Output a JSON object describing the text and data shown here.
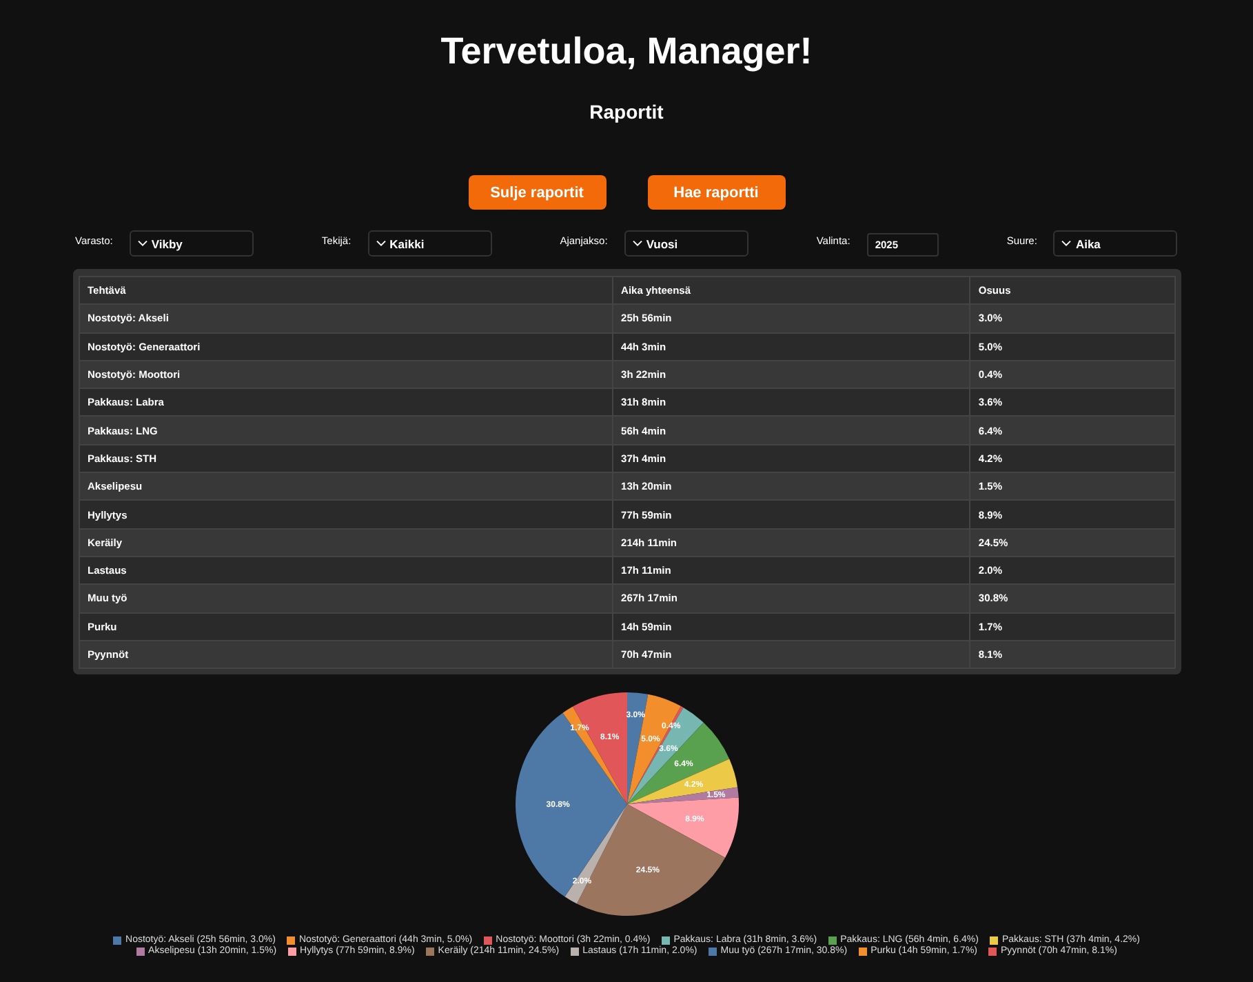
{
  "title": "Tervetuloa, Manager!",
  "subtitle": "Raportit",
  "buttons": [
    "Sulje raportit",
    "Hae raportti"
  ],
  "filters": [
    {
      "kind": "select",
      "label": "Varasto:",
      "value": "Vikby"
    },
    {
      "kind": "select",
      "label": "Tekijä:",
      "value": "Kaikki"
    },
    {
      "kind": "select",
      "label": "Ajanjakso:",
      "value": "Vuosi"
    },
    {
      "kind": "input",
      "label": "Valinta:",
      "value": "2025"
    },
    {
      "kind": "select",
      "label": "Suure:",
      "value": "Aika"
    }
  ],
  "table": {
    "columns": [
      "Tehtävä",
      "Aika yhteensä",
      "Osuus"
    ],
    "rows": [
      [
        "Nostotyö: Akseli",
        "25h 56min",
        "3.0%"
      ],
      [
        "Nostotyö: Generaattori",
        "44h 3min",
        "5.0%"
      ],
      [
        "Nostotyö: Moottori",
        "3h 22min",
        "0.4%"
      ],
      [
        "Pakkaus: Labra",
        "31h 8min",
        "3.6%"
      ],
      [
        "Pakkaus: LNG",
        "56h 4min",
        "6.4%"
      ],
      [
        "Pakkaus: STH",
        "37h 4min",
        "4.2%"
      ],
      [
        "Akselipesu",
        "13h 20min",
        "1.5%"
      ],
      [
        "Hyllytys",
        "77h 59min",
        "8.9%"
      ],
      [
        "Keräily",
        "214h 11min",
        "24.5%"
      ],
      [
        "Lastaus",
        "17h 11min",
        "2.0%"
      ],
      [
        "Muu työ",
        "267h 17min",
        "30.8%"
      ],
      [
        "Purku",
        "14h 59min",
        "1.7%"
      ],
      [
        "Pyynnöt",
        "70h 47min",
        "8.1%"
      ]
    ]
  },
  "chart": {
    "legend": [
      "Nostotyö: Akseli (25h 56min, 3.0%)",
      "Nostotyö: Generaattori (44h 3min, 5.0%)",
      "Nostotyö: Moottori (3h 22min, 0.4%)",
      "Pakkaus: Labra (31h 8min, 3.6%)",
      "Pakkaus: LNG (56h 4min, 6.4%)",
      "Pakkaus: STH (37h 4min, 4.2%)",
      "Akselipesu (13h 20min, 1.5%)",
      "Hyllytys (77h 59min, 8.9%)",
      "Keräily (214h 11min, 24.5%)",
      "Lastaus (17h 11min, 2.0%)",
      "Muu työ (267h 17min, 30.8%)",
      "Purku (14h 59min, 1.7%)",
      "Pyynnöt (70h 47min, 8.1%)"
    ],
    "chart_data": {
      "type": "pie",
      "series": [
        {
          "values": [
            3.0,
            5.0,
            0.4,
            3.6,
            6.4,
            4.2,
            1.5,
            8.9,
            24.5,
            2.0,
            30.8,
            1.7,
            8.1
          ],
          "colors": [
            "#4e79a7",
            "#f28e2b",
            "#e15759",
            "#76b7b2",
            "#59a14f",
            "#edc948",
            "#b07aa1",
            "#ff9da7",
            "#9c755f",
            "#bab0ac",
            "#4e79a7",
            "#f28e2b",
            "#e15759"
          ]
        }
      ],
      "value_labels": [
        "3.0%",
        "5.0%",
        "0.4%",
        "3.6%",
        "6.4%",
        "4.2%",
        "1.5%",
        "8.9%",
        "24.5%",
        "2.0%",
        "30.8%",
        "1.7%",
        "8.1%"
      ]
    }
  }
}
